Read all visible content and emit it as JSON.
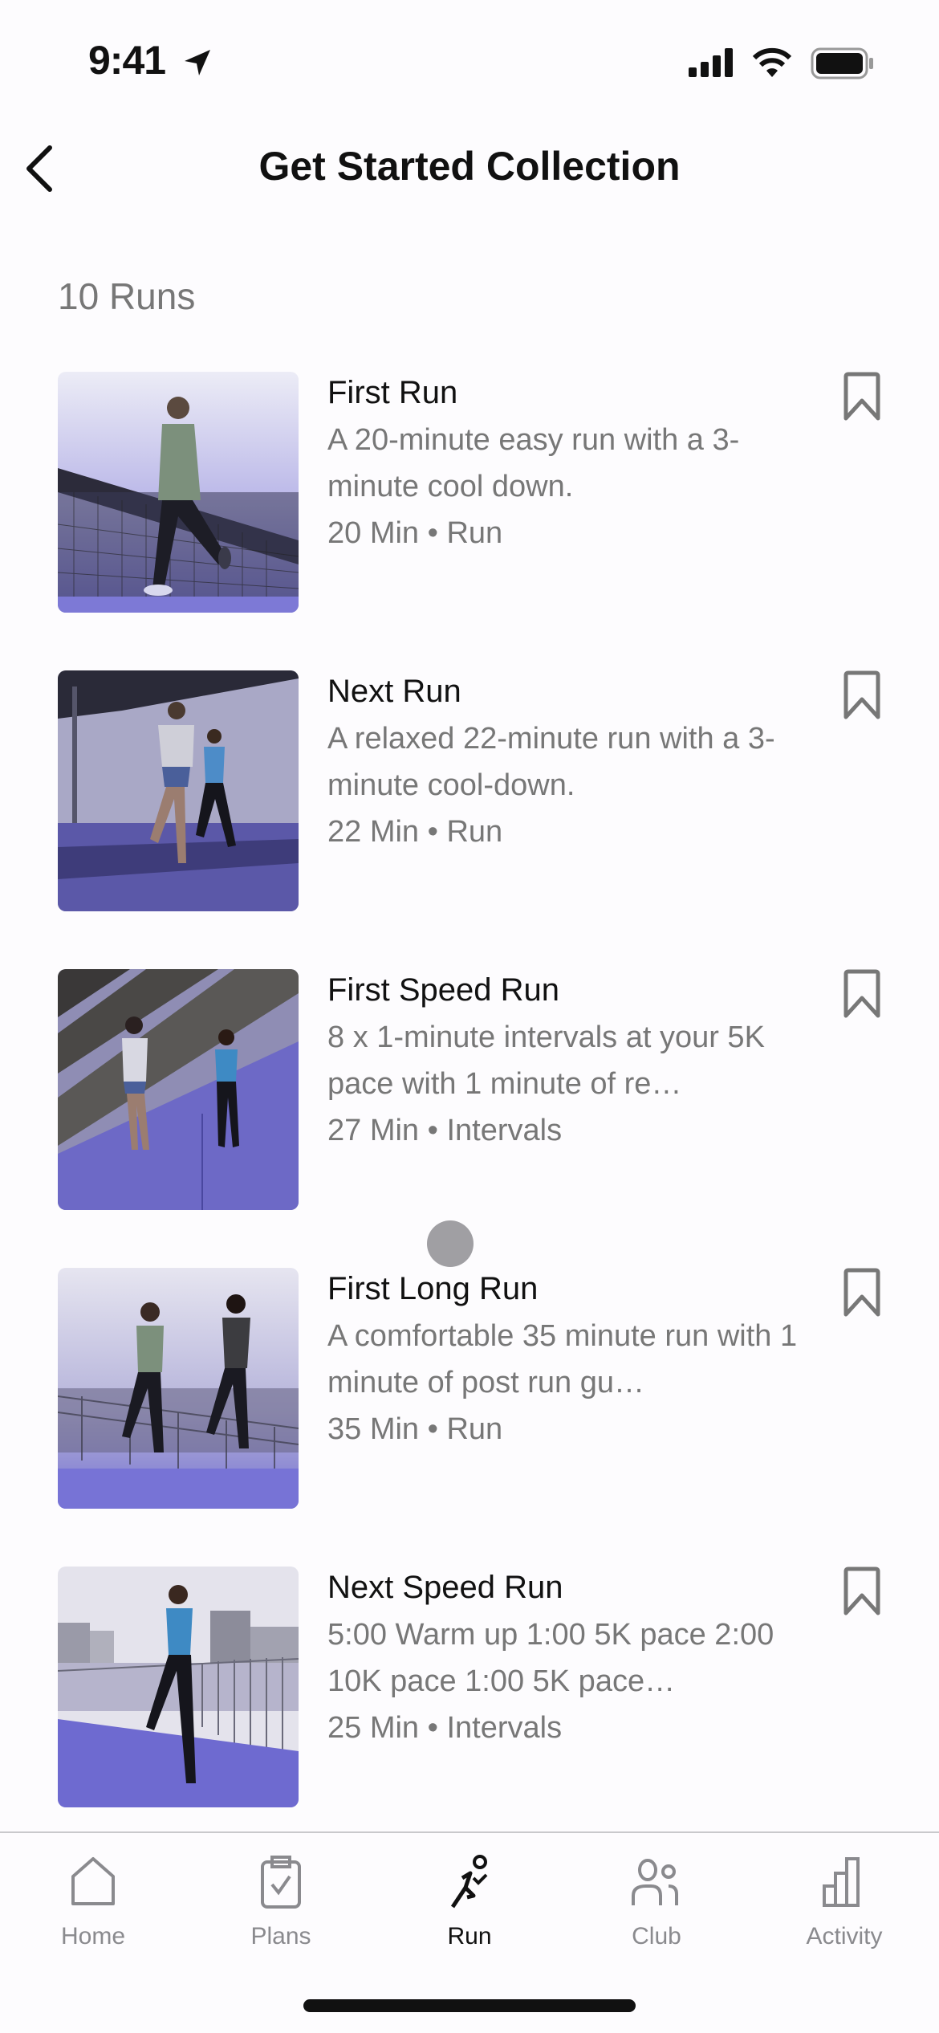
{
  "status_bar": {
    "time": "9:41",
    "icons": [
      "location-arrow-icon",
      "cellular-signal-icon",
      "wifi-icon",
      "battery-icon"
    ]
  },
  "header": {
    "back_icon": "chevron-left-icon",
    "title": "Get Started Collection"
  },
  "collection": {
    "count_label": "10 Runs",
    "items": [
      {
        "title": "First Run",
        "description": "A 20-minute easy run with a 3-minute cool down.",
        "meta": "20 Min • Run",
        "image": "woman-running-by-fence-photo",
        "bookmarked": false
      },
      {
        "title": "Next Run",
        "description": "A relaxed 22-minute run with a 3-minute cool-down.",
        "meta": "22 Min • Run",
        "image": "two-runners-under-bridge-photo",
        "bookmarked": false
      },
      {
        "title": "First Speed Run",
        "description": "8 x 1-minute intervals at your 5K pace with 1 minute of re…",
        "meta": "27 Min • Intervals",
        "image": "two-runners-on-ramp-photo",
        "bookmarked": false
      },
      {
        "title": "First Long Run",
        "description": "A comfortable 35 minute run with 1 minute of post run gu…",
        "meta": "35 Min • Run",
        "image": "two-runners-on-bridge-photo",
        "bookmarked": false
      },
      {
        "title": "Next Speed Run",
        "description": "5:00 Warm up 1:00 5K pace 2:00 10K pace 1:00 5K pace…",
        "meta": "25 Min • Intervals",
        "image": "woman-running-city-photo",
        "bookmarked": false
      }
    ]
  },
  "tab_bar": {
    "active": "Run",
    "tabs": [
      {
        "label": "Home",
        "icon": "home-icon"
      },
      {
        "label": "Plans",
        "icon": "clipboard-check-icon"
      },
      {
        "label": "Run",
        "icon": "runner-icon"
      },
      {
        "label": "Club",
        "icon": "people-icon"
      },
      {
        "label": "Activity",
        "icon": "bar-chart-icon"
      }
    ]
  },
  "colors": {
    "background": "#fdfcfe",
    "primary_text": "#111111",
    "secondary_text": "#777777",
    "tab_inactive": "#8a8a8e",
    "image_tint": "#6f6bd0"
  }
}
